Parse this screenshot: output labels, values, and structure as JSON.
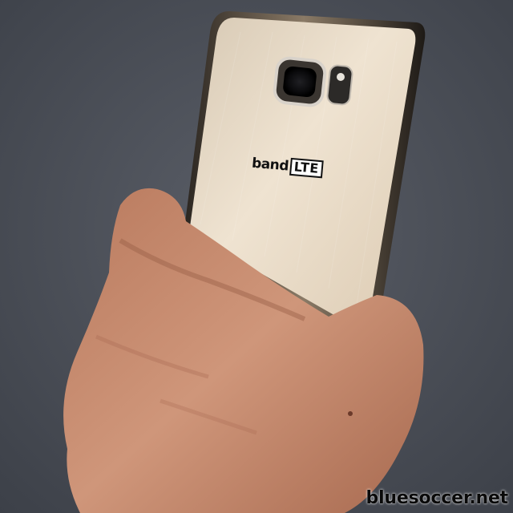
{
  "phone": {
    "logo_band": "band",
    "logo_lte": "LTE"
  },
  "watermark": {
    "text": "bluesoccer.net"
  },
  "colors": {
    "background": "#4b4f58",
    "phone_back": "#e6d8c4",
    "skin": "#c78d70"
  }
}
